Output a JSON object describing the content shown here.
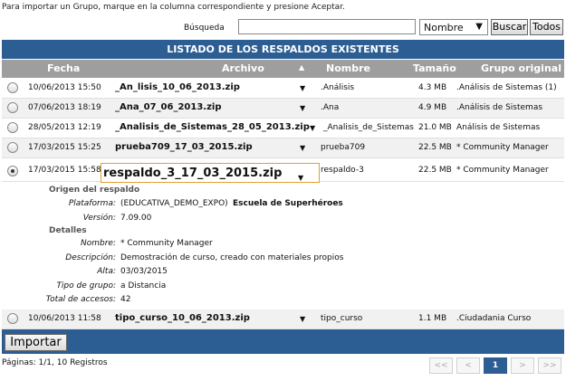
{
  "instruction": "Para importar un Grupo, marque en la columna correspondiente y presione Aceptar.",
  "search": {
    "label": "Búsqueda",
    "value": "",
    "field": "Nombre",
    "buscar_label": "Buscar",
    "todos_label": "Todos"
  },
  "table": {
    "title": "LISTADO DE LOS RESPALDOS EXISTENTES",
    "headers": {
      "fecha": "Fecha",
      "archivo": "Archivo",
      "nombre": "Nombre",
      "tamano": "Tamaño",
      "grupo": "Grupo original"
    },
    "sort_indicator": "▲",
    "rows": [
      {
        "fecha": "10/06/2013 15:50",
        "archivo": "_An_lisis_10_06_2013.zip",
        "nombre": ".Análisis",
        "tamano": "4.3 MB",
        "grupo": ".Análisis de Sistemas (1)",
        "selected": false
      },
      {
        "fecha": "07/06/2013 18:19",
        "archivo": "_Ana_07_06_2013.zip",
        "nombre": ".Ana",
        "tamano": "4.9 MB",
        "grupo": ".Análisis de Sistemas",
        "selected": false
      },
      {
        "fecha": "28/05/2013 12:19",
        "archivo": "_Analisis_de_Sistemas_28_05_2013.zip",
        "nombre": "_Analisis_de_Sistemas",
        "tamano": "21.0 MB",
        "grupo": "Análisis de Sistemas",
        "selected": false
      },
      {
        "fecha": "17/03/2015 15:25",
        "archivo": "prueba709_17_03_2015.zip",
        "nombre": "prueba709",
        "tamano": "22.5 MB",
        "grupo": "* Community Manager",
        "selected": false
      },
      {
        "fecha": "17/03/2015 15:58",
        "archivo": "respaldo_3_17_03_2015.zip",
        "nombre": "respaldo-3",
        "tamano": "22.5 MB",
        "grupo": "* Community Manager",
        "selected": true
      },
      {
        "fecha": "10/06/2013 11:58",
        "archivo": "tipo_curso_10_06_2013.zip",
        "nombre": "tipo_curso",
        "tamano": "1.1 MB",
        "grupo": ".Ciudadania Curso",
        "selected": false
      }
    ]
  },
  "detail": {
    "origen_title": "Origen del respaldo",
    "plataforma_label": "Plataforma:",
    "plataforma_code": "(EDUCATIVA_DEMO_EXPO)",
    "plataforma_name": "Escuela de Superhéroes",
    "version_label": "Versión:",
    "version_value": "7.09.00",
    "detalles_title": "Detalles",
    "nombre_label": "Nombre:",
    "nombre_value": "* Community Manager",
    "descripcion_label": "Descripción:",
    "descripcion_value": "Demostración de curso, creado con materiales propios",
    "alta_label": "Alta:",
    "alta_value": "03/03/2015",
    "tipo_label": "Tipo de grupo:",
    "tipo_value": "a Distancia",
    "accesos_label": "Total de accesos:",
    "accesos_value": "42"
  },
  "importar_label": "Importar",
  "pagination": {
    "summary": "Páginas: 1/1, 10 Registros",
    "first": "<<",
    "prev": "<",
    "current": "1",
    "next": ">",
    "last": ">>"
  },
  "colors": {
    "header_blue": "#2c5e93",
    "column_gray": "#9e9e9e",
    "highlight": "#e0a030"
  }
}
